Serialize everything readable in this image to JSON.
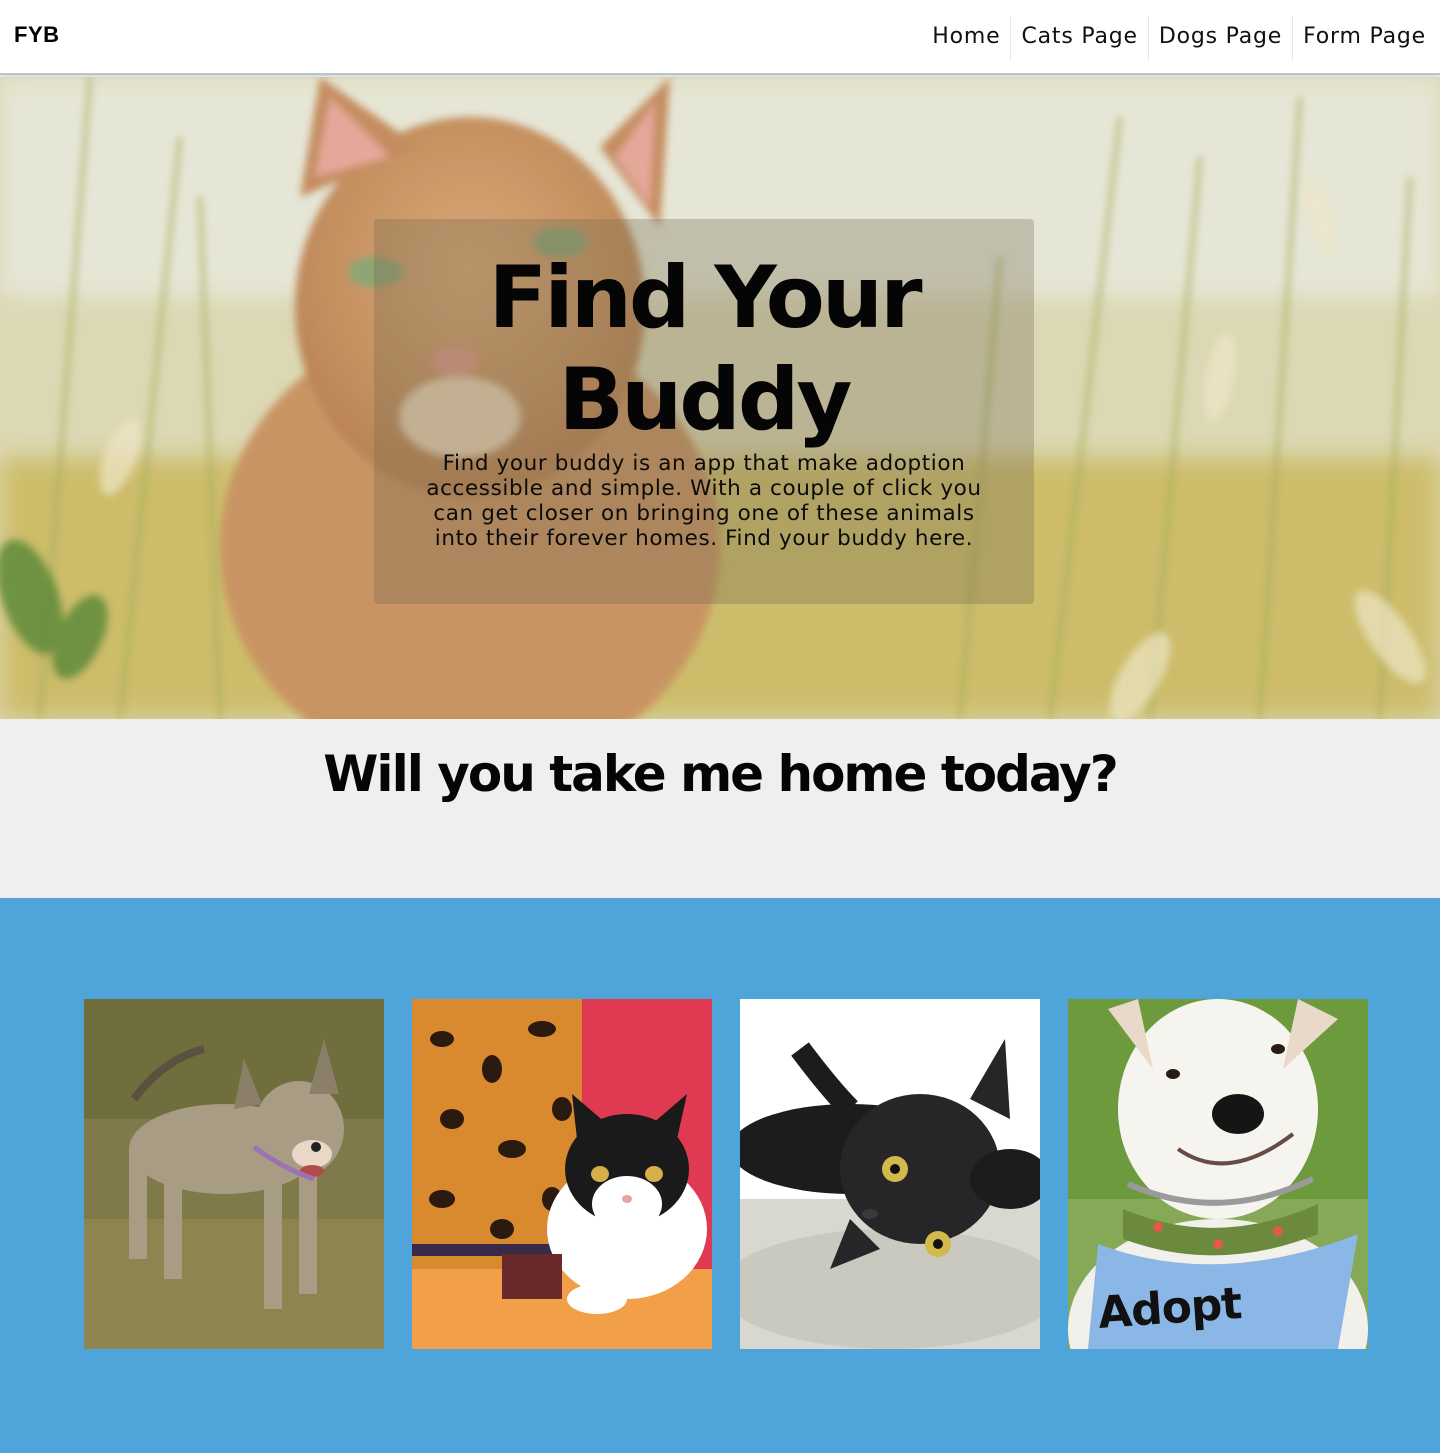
{
  "nav": {
    "brand": "FYB",
    "links": [
      "Home",
      "Cats Page",
      "Dogs Page",
      "Form Page"
    ]
  },
  "hero": {
    "title_line1": "Find Your",
    "title_line2": "Buddy",
    "description": "Find your buddy is an app that make adoption accessible and simple. With a couple of click you can get closer on bringing one of these animals into their forever homes. Find your buddy here."
  },
  "tagline": "Will you take me home today?",
  "gallery": {
    "photos": [
      {
        "subject": "dog-photo"
      },
      {
        "subject": "cat-photo"
      },
      {
        "subject": "cat-photo"
      },
      {
        "subject": "dog-photo",
        "badge_text": "Adopt"
      }
    ]
  },
  "colors": {
    "gallery_bg": "#4fa5da",
    "tagline_bg": "#efefef",
    "navbar_bg": "#ffffff"
  }
}
